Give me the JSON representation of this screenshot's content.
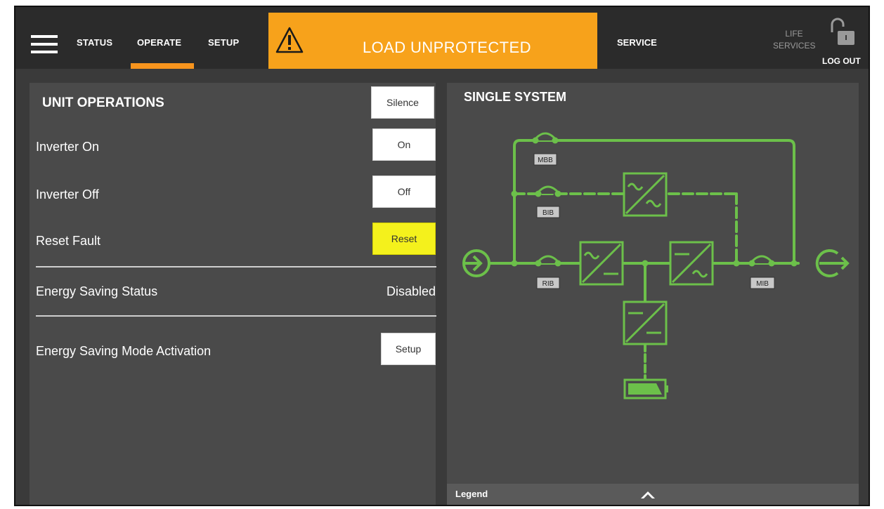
{
  "header": {
    "tabs": [
      {
        "label": "STATUS"
      },
      {
        "label": "OPERATE",
        "active": true
      },
      {
        "label": "SETUP"
      }
    ],
    "alarm_text": "LOAD UNPROTECTED",
    "service_label": "SERVICE",
    "life_services_line1": "LIFE",
    "life_services_line2": "SERVICES",
    "logout_label": "LOG OUT"
  },
  "unit_operations": {
    "title": "UNIT OPERATIONS",
    "silence_label": "Silence",
    "rows": [
      {
        "label": "Inverter On",
        "button": "On"
      },
      {
        "label": "Inverter Off",
        "button": "Off"
      },
      {
        "label": "Reset Fault",
        "button": "Reset"
      }
    ],
    "energy_saving_status_label": "Energy Saving Status",
    "energy_saving_status_value": "Disabled",
    "energy_saving_activation_label": "Energy Saving Mode Activation",
    "energy_saving_activation_button": "Setup"
  },
  "single_system": {
    "title": "SINGLE SYSTEM",
    "breakers": {
      "mbb": "MBB",
      "bib": "BIB",
      "rib": "RIB",
      "mib": "MIB"
    },
    "legend_label": "Legend"
  },
  "colors": {
    "alarm": "#f7a21b",
    "active_tab": "#f7941d",
    "line_green": "#6cc04a",
    "reset_button": "#f4f11c"
  },
  "icons": [
    "menu-icon",
    "warning-icon",
    "unlock-icon",
    "input-arrow-icon",
    "output-arrow-icon",
    "battery-icon",
    "chevron-up-icon"
  ]
}
